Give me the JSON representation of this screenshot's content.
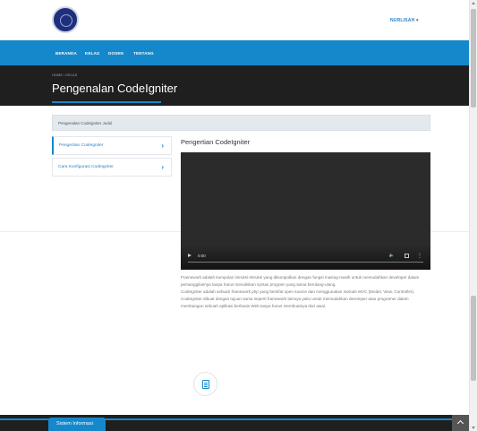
{
  "header": {
    "user_menu": "NURLISAH ▾"
  },
  "nav": {
    "items": [
      {
        "label": "BERANDA"
      },
      {
        "label": "KELAS"
      },
      {
        "label": "DOSEN"
      },
      {
        "label": "TENTANG"
      }
    ]
  },
  "hero": {
    "breadcrumb_home": "HOME",
    "breadcrumb_sep": " / ",
    "breadcrumb_current": "KELAS",
    "title": "Pengenalan CodeIgniter"
  },
  "course": {
    "bar_label": "Pengenalan Codeigniter Judul"
  },
  "sidebar": {
    "items": [
      {
        "label": "Pengertian CodeIgniter",
        "chevron": "›",
        "active": true
      },
      {
        "label": "Cara Konfigurasi CodeIgniter",
        "chevron": "›",
        "active": false
      }
    ]
  },
  "content": {
    "title": "Pengertian CodeIgniter",
    "video": {
      "time": "0:00",
      "volume_icon": "🔈",
      "more_icon": "⋮"
    },
    "description": "Framework adalah kumpulan intruksi-intruksi yang dikumpulkan dengan fungsi masing-masih untuk memudahkan developer dalam pemanggilannya tanpa harus menuliskan syntax program yang sama berulang-ulang.\nCodeIgniter adalah sebuah framework php yang bersifat open source dan menggunakan metode MVC (Model, View, Controller). CodeIgniter dibuat dengan tujuan sama seperti framework lainnya yaitu untuk memudahkan developer atau programer dalam membangun sebuah aplikasi berbasis Web tanpa harus membuatnya dari awal."
  },
  "footer": {
    "info_tab": "Sistem Informasi"
  },
  "colors": {
    "primary": "#1588cc",
    "dark": "#1f1f1f",
    "link": "#2d7fc1"
  }
}
